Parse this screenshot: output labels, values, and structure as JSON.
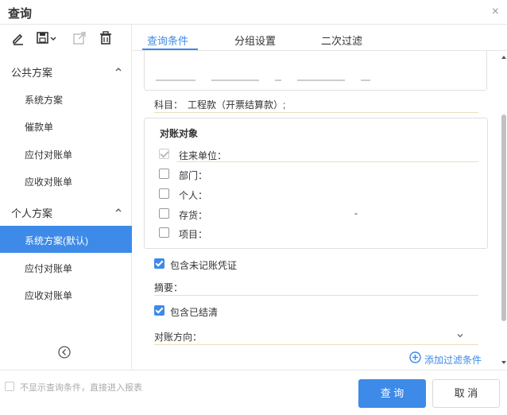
{
  "window": {
    "title": "查询",
    "close_glyph": "×"
  },
  "toolbar": {
    "icons": [
      "edit-icon",
      "save-icon",
      "export-icon",
      "delete-icon"
    ]
  },
  "sidebar": {
    "public_section": {
      "label": "公共方案"
    },
    "public_items": [
      {
        "label": "系统方案"
      },
      {
        "label": "催款单"
      },
      {
        "label": "应付对账单"
      },
      {
        "label": "应收对账单"
      }
    ],
    "personal_section": {
      "label": "个人方案"
    },
    "personal_items": [
      {
        "label": "系统方案(默认)",
        "active": true
      },
      {
        "label": "应付对账单"
      },
      {
        "label": "应收对账单"
      }
    ]
  },
  "tabs": [
    {
      "label": "查询条件",
      "active": true
    },
    {
      "label": "分组设置"
    },
    {
      "label": "二次过滤"
    }
  ],
  "query": {
    "subject_label": "科目：",
    "subject_value": "工程款（开票结算款）;",
    "group_title": "对账对象",
    "objects": [
      {
        "label": "往来单位：",
        "checked": true,
        "disabled": true
      },
      {
        "label": "部门：",
        "checked": false
      },
      {
        "label": "个人：",
        "checked": false
      },
      {
        "label": "存货：",
        "checked": false,
        "trailing": "-"
      },
      {
        "label": "项目：",
        "checked": false
      }
    ],
    "include_unposted": "包含未记账凭证",
    "summary_label": "摘要：",
    "include_settled": "包含已结清",
    "direction_label": "对账方向：",
    "add_filter": "添加过滤条件"
  },
  "footer": {
    "skip_label": "不显示查询条件，直接进入报表",
    "query_button": "查 询",
    "cancel_button": "取 消"
  },
  "colors": {
    "accent": "#3d8ae8"
  }
}
